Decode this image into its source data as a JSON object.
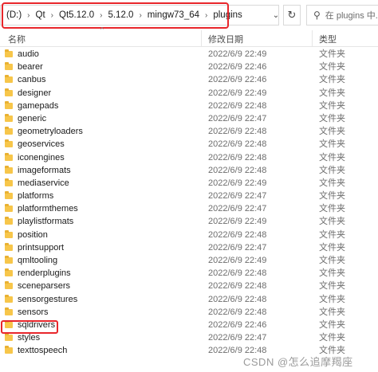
{
  "address": {
    "segments": [
      "(D:)",
      "Qt",
      "Qt5.12.0",
      "5.12.0",
      "mingw73_64",
      "plugins"
    ],
    "separator": "›"
  },
  "search": {
    "placeholder": "在 plugins 中..."
  },
  "columns": {
    "name": "名称",
    "date": "修改日期",
    "type": "类型"
  },
  "files": [
    {
      "name": "audio",
      "date": "2022/6/9 22:49",
      "type": "文件夹"
    },
    {
      "name": "bearer",
      "date": "2022/6/9 22:46",
      "type": "文件夹"
    },
    {
      "name": "canbus",
      "date": "2022/6/9 22:46",
      "type": "文件夹"
    },
    {
      "name": "designer",
      "date": "2022/6/9 22:49",
      "type": "文件夹"
    },
    {
      "name": "gamepads",
      "date": "2022/6/9 22:48",
      "type": "文件夹"
    },
    {
      "name": "generic",
      "date": "2022/6/9 22:47",
      "type": "文件夹"
    },
    {
      "name": "geometryloaders",
      "date": "2022/6/9 22:48",
      "type": "文件夹"
    },
    {
      "name": "geoservices",
      "date": "2022/6/9 22:48",
      "type": "文件夹"
    },
    {
      "name": "iconengines",
      "date": "2022/6/9 22:48",
      "type": "文件夹"
    },
    {
      "name": "imageformats",
      "date": "2022/6/9 22:48",
      "type": "文件夹"
    },
    {
      "name": "mediaservice",
      "date": "2022/6/9 22:49",
      "type": "文件夹"
    },
    {
      "name": "platforms",
      "date": "2022/6/9 22:47",
      "type": "文件夹"
    },
    {
      "name": "platformthemes",
      "date": "2022/6/9 22:47",
      "type": "文件夹"
    },
    {
      "name": "playlistformats",
      "date": "2022/6/9 22:49",
      "type": "文件夹"
    },
    {
      "name": "position",
      "date": "2022/6/9 22:48",
      "type": "文件夹"
    },
    {
      "name": "printsupport",
      "date": "2022/6/9 22:47",
      "type": "文件夹"
    },
    {
      "name": "qmltooling",
      "date": "2022/6/9 22:49",
      "type": "文件夹"
    },
    {
      "name": "renderplugins",
      "date": "2022/6/9 22:48",
      "type": "文件夹"
    },
    {
      "name": "sceneparsers",
      "date": "2022/6/9 22:48",
      "type": "文件夹"
    },
    {
      "name": "sensorgestures",
      "date": "2022/6/9 22:48",
      "type": "文件夹"
    },
    {
      "name": "sensors",
      "date": "2022/6/9 22:48",
      "type": "文件夹"
    },
    {
      "name": "sqldrivers",
      "date": "2022/6/9 22:46",
      "type": "文件夹"
    },
    {
      "name": "styles",
      "date": "2022/6/9 22:47",
      "type": "文件夹"
    },
    {
      "name": "texttospeech",
      "date": "2022/6/9 22:48",
      "type": "文件夹"
    }
  ],
  "watermark": "CSDN @怎么追摩羯座",
  "colors": {
    "highlight": "#e8262b",
    "folder": "#f7c64a"
  }
}
